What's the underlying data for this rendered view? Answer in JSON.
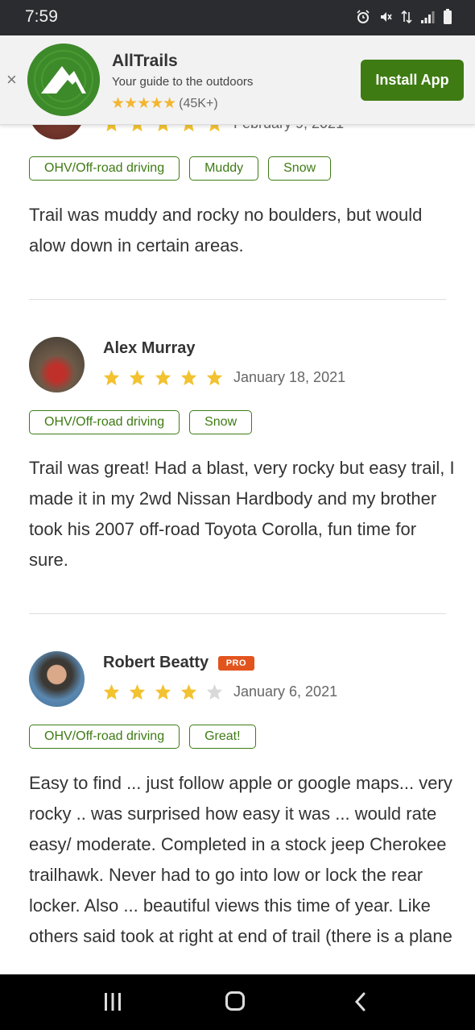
{
  "status_bar": {
    "time": "7:59",
    "icons": [
      "alarm-icon",
      "mute-icon",
      "data-arrows-icon",
      "signal-icon",
      "battery-icon"
    ]
  },
  "banner": {
    "close_glyph": "×",
    "app_name": "AllTrails",
    "tagline": "Your guide to the outdoors",
    "stars": "★★★★★",
    "rating_count": "(45K+)",
    "install_label": "Install App",
    "brand_color": "#3e7b13"
  },
  "reviews": [
    {
      "name": "",
      "stars": 5,
      "date": "February 9, 2021",
      "tags": [
        "OHV/Off-road driving",
        "Muddy",
        "Snow"
      ],
      "text": "Trail was muddy and rocky no boulders, but would alow down in certain areas."
    },
    {
      "name": "Alex Murray",
      "stars": 5,
      "date": "January 18, 2021",
      "tags": [
        "OHV/Off-road driving",
        "Snow"
      ],
      "text": "Trail was great! Had a blast, very rocky but easy trail, I made it in my 2wd Nissan Hardbody and my brother took his 2007 off-road Toyota Corolla, fun time for sure."
    },
    {
      "name": "Robert Beatty",
      "badge": "PRO",
      "stars": 4,
      "date": "January 6, 2021",
      "tags": [
        "OHV/Off-road driving",
        "Great!"
      ],
      "text": "Easy to find ... just follow apple or google maps... very rocky .. was surprised how easy it was ... would rate easy/ moderate.  Completed in a stock jeep Cherokee trailhawk.   Never had to go into low or lock the rear locker.  Also ... beautiful views this time of year.  Like others said took at right at end of trail (there is a plane"
    }
  ],
  "colors": {
    "star_filled": "#f2c230",
    "star_empty": "#d9d9d9",
    "pro_badge": "#e2541e"
  },
  "nav": {
    "recent": "recent-apps-icon",
    "home": "home-icon",
    "back": "back-icon"
  }
}
